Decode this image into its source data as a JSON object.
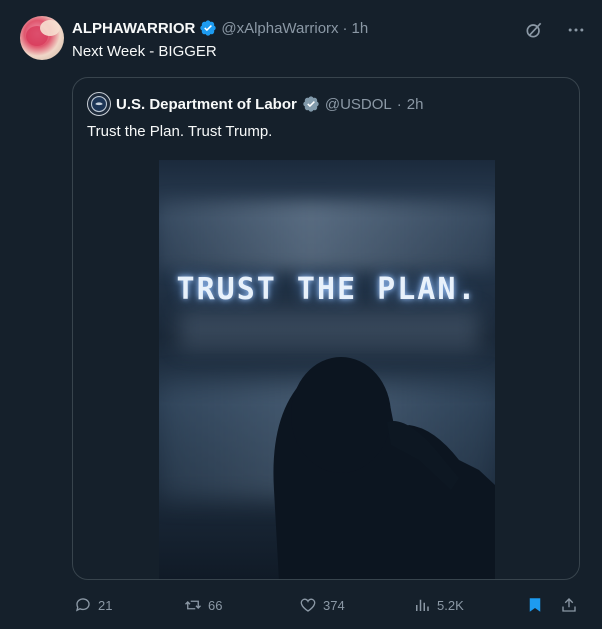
{
  "tweet": {
    "display_name": "ALPHAWARRIOR",
    "handle": "@xAlphaWarriorx",
    "separator": "·",
    "time": "1h",
    "text": "Next Week - BIGGER"
  },
  "quoted": {
    "display_name": "U.S. Department of Labor",
    "handle": "@USDOL",
    "separator": "·",
    "time": "2h",
    "text": "Trust the Plan. Trust Trump.",
    "image_text": "TRUST THE PLAN."
  },
  "actions": {
    "replies": "21",
    "retweets": "66",
    "likes": "374",
    "views": "5.2K"
  },
  "colors": {
    "background": "#15202b",
    "verified_blue": "#1d9bf0",
    "verified_gray": "#829aab",
    "muted": "#8b98a5",
    "bookmark_active": "#1d9bf0"
  },
  "icons": [
    "grok-icon",
    "more-icon",
    "reply-icon",
    "retweet-icon",
    "like-icon",
    "views-icon",
    "bookmark-icon",
    "share-icon"
  ]
}
